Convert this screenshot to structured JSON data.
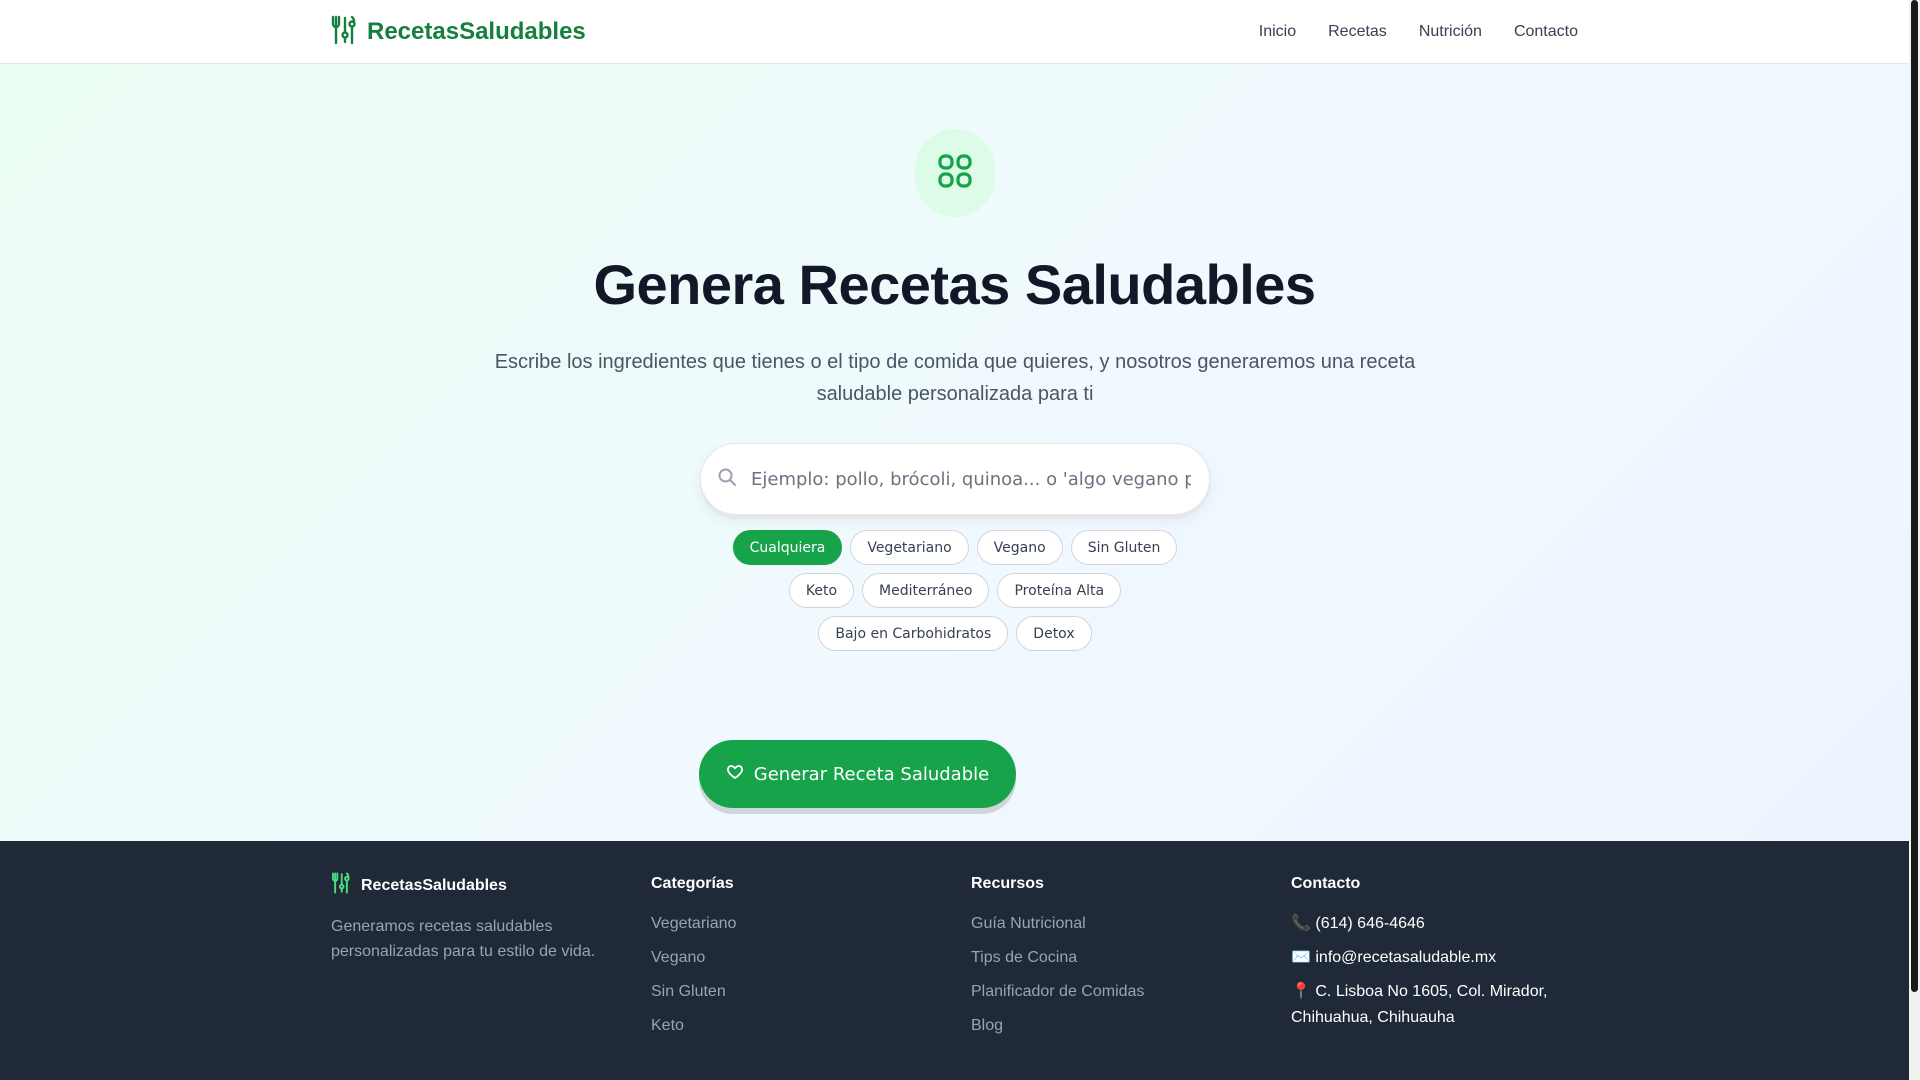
{
  "header": {
    "logo_text": "RecetasSaludables",
    "logo_icon": "utensils-icon",
    "nav": [
      "Inicio",
      "Recetas",
      "Nutrición",
      "Contacto"
    ]
  },
  "hero": {
    "icon": "grid-icon",
    "title": "Genera Recetas Saludables",
    "subtitle": "Escribe los ingredientes que tienes o el tipo de comida que quieres, y nosotros generaremos una receta saludable personalizada para ti",
    "search_placeholder": "Ejemplo: pollo, brócoli, quinoa... o 'algo vegano para cenar'",
    "search_icon": "search-icon",
    "chips": [
      "Cualquiera",
      "Vegetariano",
      "Vegano",
      "Sin Gluten",
      "Keto",
      "Mediterráneo",
      "Proteína Alta",
      "Bajo en Carbohidratos",
      "Detox"
    ],
    "selected_chip": "Cualquiera",
    "generate_label": "Generar Receta Saludable",
    "generate_icon": "heart-icon"
  },
  "footer": {
    "brand": "RecetasSaludables",
    "description": "Generamos recetas saludables personalizadas para tu estilo de vida.",
    "categories": {
      "title": "Categorías",
      "items": [
        "Vegetariano",
        "Vegano",
        "Sin Gluten",
        "Keto"
      ]
    },
    "resources": {
      "title": "Recursos",
      "items": [
        "Guía Nutricional",
        "Tips de Cocina",
        "Planificador de Comidas",
        "Blog"
      ]
    },
    "contact": {
      "title": "Contacto",
      "phone": "📞 (614) 646-4646",
      "email": "✉️ info@recetasaludable.mx",
      "address": "📍 C. Lisboa No 1605, Col. Mirador, Chihuahua, Chihuauha"
    }
  },
  "colors": {
    "brand": "#15803d",
    "accent": "#16a34a",
    "footer_bg": "#1f2937"
  }
}
